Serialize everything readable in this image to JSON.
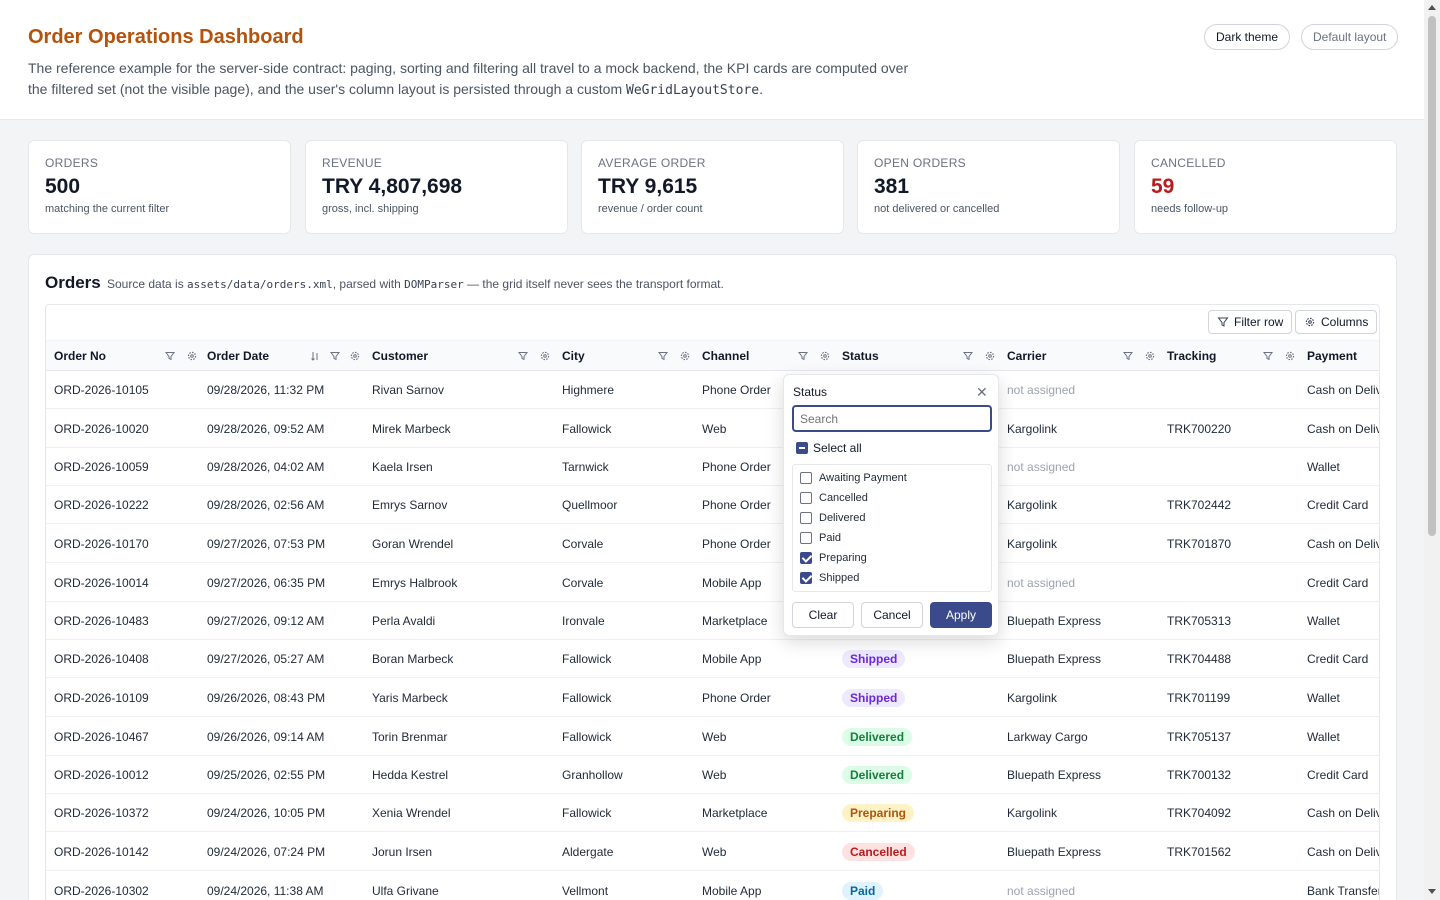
{
  "header": {
    "title": "Order Operations Dashboard",
    "desc_line1": "The reference example for the server-side contract: paging, sorting and filtering all travel to a mock backend, the KPI cards are computed over",
    "desc_line2_pre": "the filtered set (not the visible page), and the user's column layout is persisted through a custom ",
    "desc_code": "WeGridLayoutStore",
    "desc_line2_post": ".",
    "dark_theme_label": "Dark theme",
    "default_layout_label": "Default layout"
  },
  "kpis": [
    {
      "label": "ORDERS",
      "value": "500",
      "sub": "matching the current filter"
    },
    {
      "label": "REVENUE",
      "value": "TRY 4,807,698",
      "sub": "gross, incl. shipping"
    },
    {
      "label": "AVERAGE ORDER",
      "value": "TRY 9,615",
      "sub": "revenue / order count"
    },
    {
      "label": "OPEN ORDERS",
      "value": "381",
      "sub": "not delivered or cancelled"
    },
    {
      "label": "CANCELLED",
      "value": "59",
      "sub": "needs follow-up",
      "accent": "#b91c1c"
    }
  ],
  "panel": {
    "title": "Orders",
    "sub_pre": "Source data is ",
    "sub_code1": "assets/data/orders.xml",
    "sub_mid": ", parsed with ",
    "sub_code2": "DOMParser",
    "sub_post": " — the grid itself never sees the transport format."
  },
  "toolbar": {
    "filter_row_label": "Filter row",
    "columns_label": "Columns"
  },
  "columns": [
    "Order No",
    "Order Date",
    "Customer",
    "City",
    "Channel",
    "Status",
    "Carrier",
    "Tracking",
    "Payment"
  ],
  "rows": [
    {
      "order": "ORD-2026-10105",
      "date": "09/28/2026, 11:32 PM",
      "customer": "Rivan Sarnov",
      "city": "Highmere",
      "channel": "Phone Order",
      "status": "",
      "carrier": "not assigned",
      "tracking": "",
      "payment": "Cash on Delivery"
    },
    {
      "order": "ORD-2026-10020",
      "date": "09/28/2026, 09:52 AM",
      "customer": "Mirek Marbeck",
      "city": "Fallowick",
      "channel": "Web",
      "status": "",
      "carrier": "Kargolink",
      "tracking": "TRK700220",
      "payment": "Cash on Delivery"
    },
    {
      "order": "ORD-2026-10059",
      "date": "09/28/2026, 04:02 AM",
      "customer": "Kaela Irsen",
      "city": "Tarnwick",
      "channel": "Phone Order",
      "status": "",
      "carrier": "not assigned",
      "tracking": "",
      "payment": "Wallet"
    },
    {
      "order": "ORD-2026-10222",
      "date": "09/28/2026, 02:56 AM",
      "customer": "Emrys Sarnov",
      "city": "Quellmoor",
      "channel": "Phone Order",
      "status": "",
      "carrier": "Kargolink",
      "tracking": "TRK702442",
      "payment": "Credit Card"
    },
    {
      "order": "ORD-2026-10170",
      "date": "09/27/2026, 07:53 PM",
      "customer": "Goran Wrendel",
      "city": "Corvale",
      "channel": "Phone Order",
      "status": "",
      "carrier": "Kargolink",
      "tracking": "TRK701870",
      "payment": "Cash on Delivery"
    },
    {
      "order": "ORD-2026-10014",
      "date": "09/27/2026, 06:35 PM",
      "customer": "Emrys Halbrook",
      "city": "Corvale",
      "channel": "Mobile App",
      "status": "",
      "carrier": "not assigned",
      "tracking": "",
      "payment": "Credit Card"
    },
    {
      "order": "ORD-2026-10483",
      "date": "09/27/2026, 09:12 AM",
      "customer": "Perla Avaldi",
      "city": "Ironvale",
      "channel": "Marketplace",
      "status": "",
      "carrier": "Bluepath Express",
      "tracking": "TRK705313",
      "payment": "Wallet"
    },
    {
      "order": "ORD-2026-10408",
      "date": "09/27/2026, 05:27 AM",
      "customer": "Boran Marbeck",
      "city": "Fallowick",
      "channel": "Mobile App",
      "status": "Shipped",
      "carrier": "Bluepath Express",
      "tracking": "TRK704488",
      "payment": "Credit Card"
    },
    {
      "order": "ORD-2026-10109",
      "date": "09/26/2026, 08:43 PM",
      "customer": "Yaris Marbeck",
      "city": "Fallowick",
      "channel": "Phone Order",
      "status": "Shipped",
      "carrier": "Kargolink",
      "tracking": "TRK701199",
      "payment": "Wallet"
    },
    {
      "order": "ORD-2026-10467",
      "date": "09/26/2026, 09:14 AM",
      "customer": "Torin Brenmar",
      "city": "Fallowick",
      "channel": "Web",
      "status": "Delivered",
      "carrier": "Larkway Cargo",
      "tracking": "TRK705137",
      "payment": "Wallet"
    },
    {
      "order": "ORD-2026-10012",
      "date": "09/25/2026, 02:55 PM",
      "customer": "Hedda Kestrel",
      "city": "Granhollow",
      "channel": "Web",
      "status": "Delivered",
      "carrier": "Bluepath Express",
      "tracking": "TRK700132",
      "payment": "Credit Card"
    },
    {
      "order": "ORD-2026-10372",
      "date": "09/24/2026, 10:05 PM",
      "customer": "Xenia Wrendel",
      "city": "Fallowick",
      "channel": "Marketplace",
      "status": "Preparing",
      "carrier": "Kargolink",
      "tracking": "TRK704092",
      "payment": "Cash on Delivery"
    },
    {
      "order": "ORD-2026-10142",
      "date": "09/24/2026, 07:24 PM",
      "customer": "Jorun Irsen",
      "city": "Aldergate",
      "channel": "Web",
      "status": "Cancelled",
      "carrier": "Bluepath Express",
      "tracking": "TRK701562",
      "payment": "Cash on Delivery"
    },
    {
      "order": "ORD-2026-10302",
      "date": "09/24/2026, 11:38 AM",
      "customer": "Ulfa Grivane",
      "city": "Vellmont",
      "channel": "Mobile App",
      "status": "Paid",
      "carrier": "not assigned",
      "tracking": "",
      "payment": "Bank Transfer"
    }
  ],
  "status_filter": {
    "title": "Status",
    "search_placeholder": "Search",
    "select_all_label": "Select all",
    "options": [
      {
        "label": "Awaiting Payment",
        "checked": false
      },
      {
        "label": "Cancelled",
        "checked": false
      },
      {
        "label": "Delivered",
        "checked": false
      },
      {
        "label": "Paid",
        "checked": false
      },
      {
        "label": "Preparing",
        "checked": true
      },
      {
        "label": "Shipped",
        "checked": true
      }
    ],
    "clear_label": "Clear",
    "cancel_label": "Cancel",
    "apply_label": "Apply"
  },
  "colors": {
    "title": "#b45309",
    "accent": "#3b4a8a",
    "danger": "#b91c1c"
  }
}
